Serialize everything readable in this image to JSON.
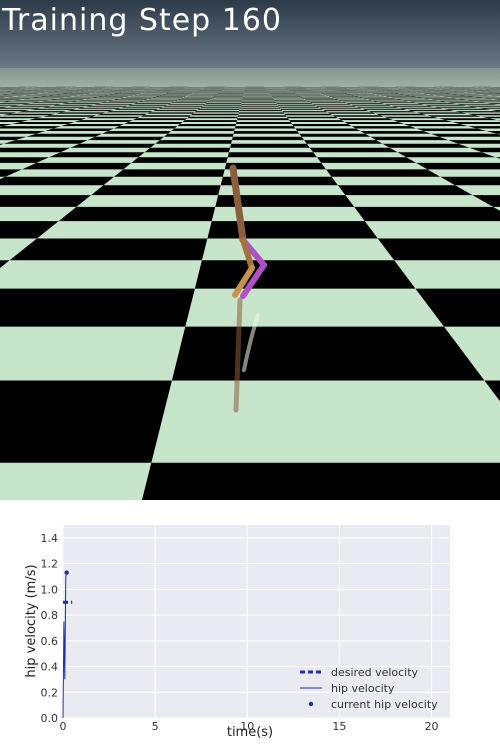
{
  "overlay": {
    "title": "Training Step 160"
  },
  "colors": {
    "sky_top": "#2d3a4a",
    "sky_bottom": "#6e7a85",
    "tile_light": "#c6e5cb",
    "tile_dark": "#000000",
    "walker_body": "#8b5e3c",
    "walker_leg_alt": "#b050c8",
    "plot_bg": "#eaeaf2",
    "series_blue": "#1f2fb0"
  },
  "chart_data": {
    "type": "line",
    "title": "",
    "xlabel": "time(s)",
    "ylabel": "hip velocity (m/s)",
    "xlim": [
      0,
      21
    ],
    "ylim": [
      0,
      1.5
    ],
    "xticks": [
      "0",
      "5",
      "10",
      "15",
      "20"
    ],
    "yticks": [
      "0.0",
      "0.2",
      "0.4",
      "0.6",
      "0.8",
      "1.0",
      "1.2",
      "1.4"
    ],
    "grid": true,
    "legend_position": "bottom-right",
    "series": [
      {
        "name": "desired velocity",
        "style": "dashed",
        "x": [
          0,
          0.5
        ],
        "y": [
          0.9,
          0.9
        ]
      },
      {
        "name": "hip velocity",
        "style": "solid",
        "x": [
          0,
          0.05,
          0.1,
          0.15,
          0.2
        ],
        "y": [
          0.0,
          0.75,
          0.3,
          1.1,
          1.13
        ]
      },
      {
        "name": "current hip velocity",
        "style": "point",
        "x": [
          0.2
        ],
        "y": [
          1.13
        ]
      }
    ]
  }
}
